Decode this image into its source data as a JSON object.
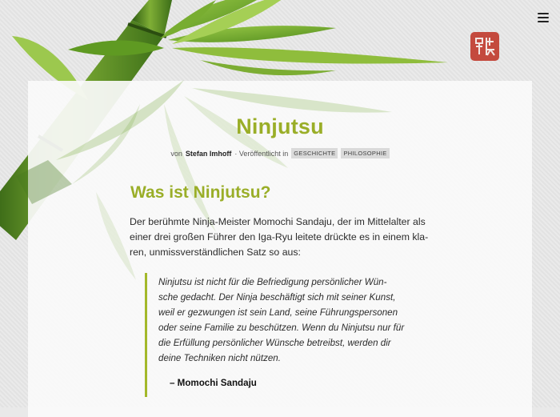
{
  "header": {
    "menu_icon": "hamburger-menu-icon",
    "seal_icon": "red-hanko-seal-icon"
  },
  "post": {
    "title": "Ninjutsu",
    "meta": {
      "by_prefix": "von",
      "author": "Stefan Imhoff",
      "published_prefix": "· Veröffentlicht in",
      "tags": [
        "GESCHICHTE",
        "PHILOSOPHIE"
      ]
    },
    "heading": "Was ist Ninjutsu?",
    "intro_lines": [
      "Der berühmte Ninja-Meister Momochi Sandaju, der im Mittelalter als",
      "einer drei großen Führer den Iga-Ryu leitete drückte es in einem kla-",
      "ren, unmissverständlichen Satz so aus:"
    ],
    "quote_lines": [
      "Ninjutsu ist nicht für die Befriedigung persönlicher Wün-",
      "sche gedacht. Der Ninja beschäftigt sich mit seiner Kunst,",
      "weil er gezwungen ist sein Land, seine Führungspersonen",
      "oder seine Familie zu beschützen. Wenn du Ninjutsu nur für",
      "die Erfüllung persönlicher Wünsche betreibst, werden dir",
      "deine Techniken nicht nützen."
    ],
    "quote_author": "– Momochi Sandaju"
  },
  "colors": {
    "accent": "#9aae28",
    "bamboo": "#5a8a1e",
    "seal": "#c0392b"
  }
}
